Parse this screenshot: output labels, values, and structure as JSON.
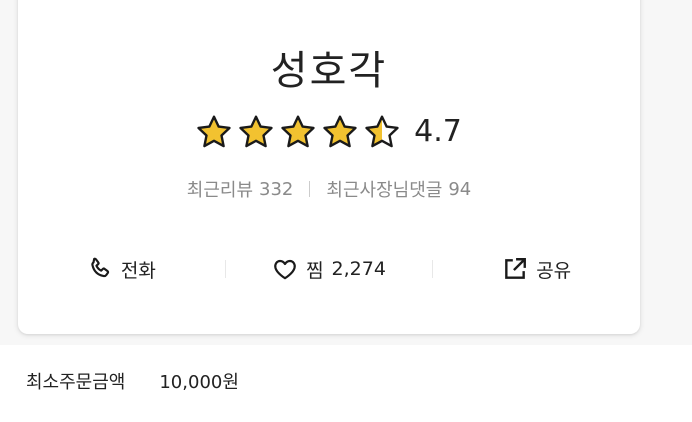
{
  "store": {
    "name": "성호각",
    "rating": "4.7",
    "stars": [
      1,
      1,
      1,
      1,
      0.5
    ]
  },
  "reviews": {
    "recent_label": "최근리뷰",
    "recent_count": "332",
    "owner_label": "최근사장님댓글",
    "owner_count": "94"
  },
  "actions": {
    "call_label": "전화",
    "like_label": "찜",
    "like_count": "2,274",
    "share_label": "공유"
  },
  "min_order": {
    "label": "최소주문금액",
    "value": "10,000원"
  },
  "colors": {
    "star_fill": "#f2c230",
    "star_outline": "#1a1a1a"
  }
}
